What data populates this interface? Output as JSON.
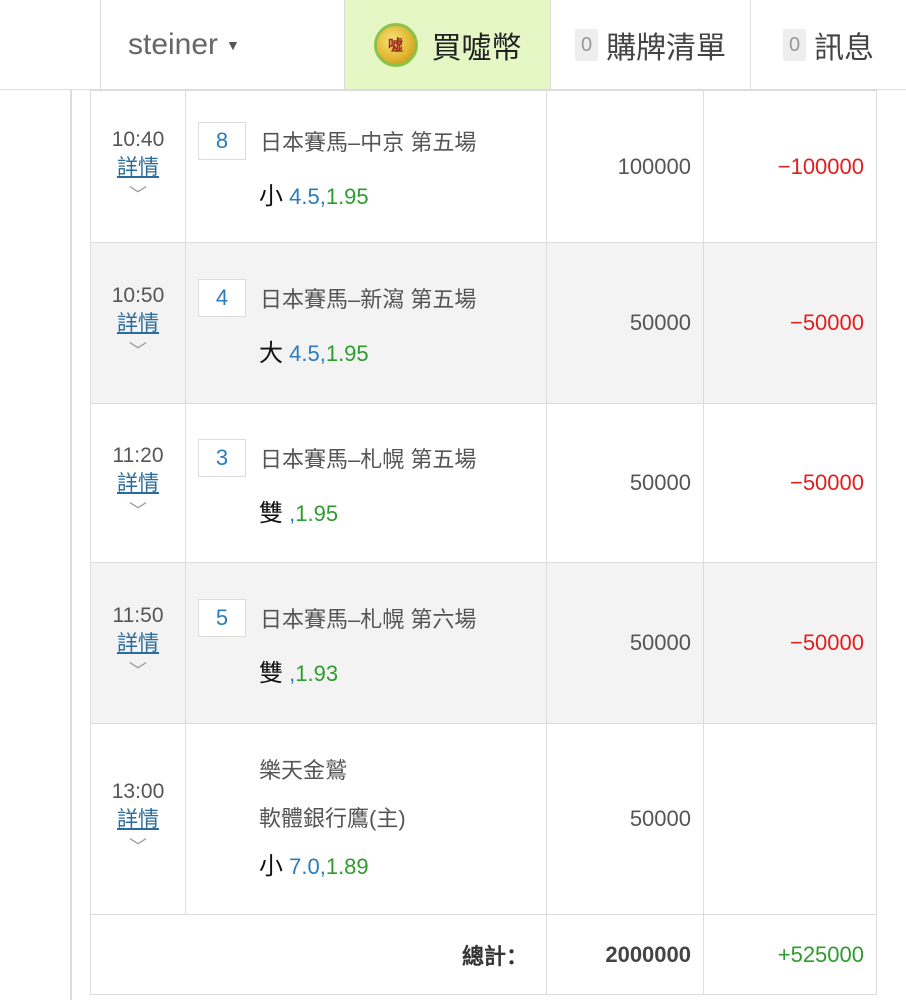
{
  "nav": {
    "username": "steiner",
    "caret_icon": "▼",
    "coin_icon_text": "噓",
    "buy_label": "買噓幣",
    "cart_count": "0",
    "cart_label": "購牌清單",
    "msg_count": "0",
    "msg_label": "訊息"
  },
  "bets": [
    {
      "time": "10:40",
      "detail": "詳情",
      "num": "8",
      "title": "日本賽馬–中京 第五場",
      "pick": "小",
      "line": "4.5,",
      "rate": "1.95",
      "amount": "100000",
      "result": "−100000"
    },
    {
      "time": "10:50",
      "detail": "詳情",
      "num": "4",
      "title": "日本賽馬–新瀉 第五場",
      "pick": "大",
      "line": "4.5,",
      "rate": "1.95",
      "amount": "50000",
      "result": "−50000"
    },
    {
      "time": "11:20",
      "detail": "詳情",
      "num": "3",
      "title": "日本賽馬–札幌 第五場",
      "pick": "雙",
      "line": ",",
      "rate": "1.95",
      "amount": "50000",
      "result": "−50000"
    },
    {
      "time": "11:50",
      "detail": "詳情",
      "num": "5",
      "title": "日本賽馬–札幌 第六場",
      "pick": "雙",
      "line": ",",
      "rate": "1.93",
      "amount": "50000",
      "result": "−50000"
    },
    {
      "time": "13:00",
      "detail": "詳情",
      "team1": "樂天金鷲",
      "team2": "軟體銀行鷹(主)",
      "pick": "小",
      "line": "7.0,",
      "rate": "1.89",
      "amount": "50000",
      "result": ""
    }
  ],
  "chevron_icon": "﹀",
  "total": {
    "label": "總計：",
    "amount": "2000000",
    "result": "+525000"
  }
}
